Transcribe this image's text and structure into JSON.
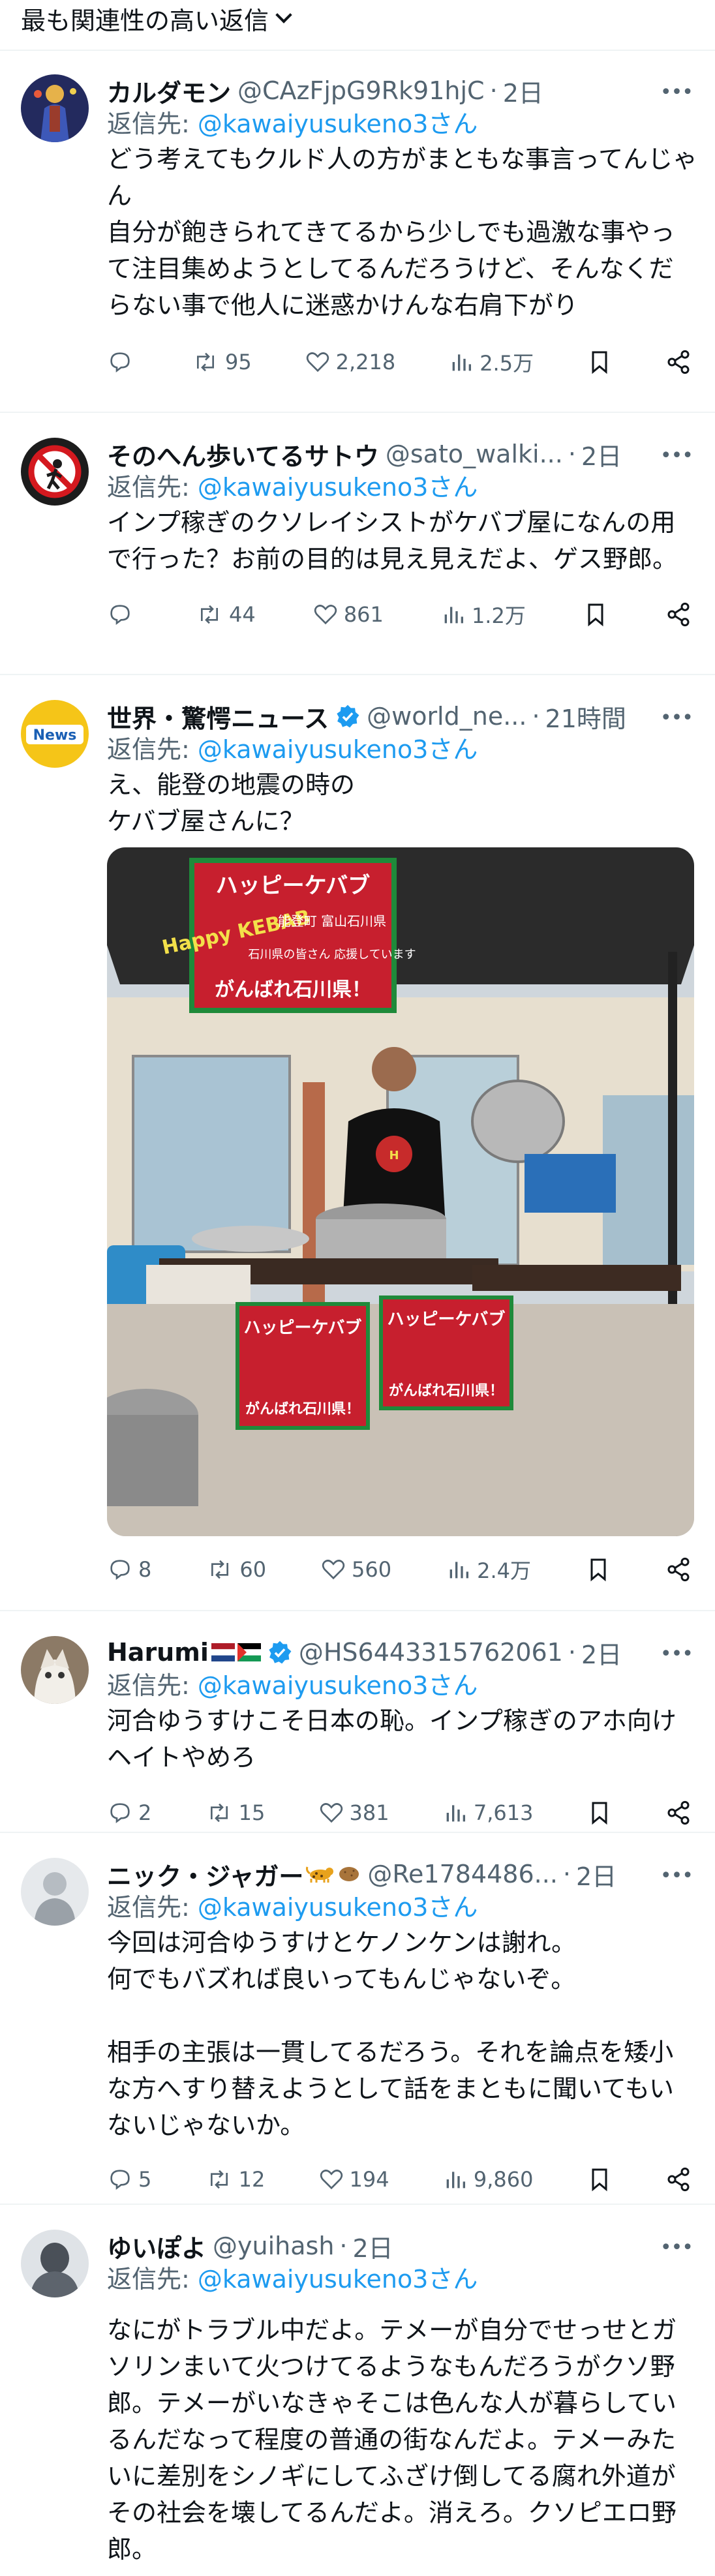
{
  "sort": {
    "label": "最も関連性の高い返信"
  },
  "reply_prefix": "返信先: ",
  "tweets": [
    {
      "name": "カルダモン",
      "handle": "@CAzFjpG9Rk91hjC",
      "time": "2日",
      "reply_to": "@kawaiyusukeno3さん",
      "text": "どう考えてもクルド人の方がまともな事言ってんじゃん\n自分が飽きられてきてるから少しでも過激な事やって注目集めようとしてるんだろうけど、そんなくだらない事で他人に迷惑かけんな右肩下がり",
      "replies": "",
      "reposts": "95",
      "likes": "2,218",
      "views": "2.5万"
    },
    {
      "name": "そのへん歩いてるサトウ",
      "handle": "@sato_walki...",
      "time": "2日",
      "reply_to": "@kawaiyusukeno3さん",
      "text": "インプ稼ぎのクソレイシストがケバブ屋になんの用で行った？お前の目的は見え見えだよ、ゲス野郎。",
      "replies": "",
      "reposts": "44",
      "likes": "861",
      "views": "1.2万"
    },
    {
      "name": "世界・驚愕ニュース",
      "handle": "@world_ne...",
      "time": "21時間",
      "reply_to": "@kawaiyusukeno3さん",
      "text": "え、能登の地震の時の\nケバブ屋さんに？",
      "avatar_text": "News",
      "image": {
        "banner_title": "ハッピーケバブ",
        "banner_sub": "能登町\n富山石川県",
        "banner_logo": "Happy KEBAB",
        "banner_msg": "石川県の皆さん\n応援しています",
        "banner_bottom": "がんばれ石川県！"
      },
      "replies": "8",
      "reposts": "60",
      "likes": "560",
      "views": "2.4万"
    },
    {
      "name": "Harumi",
      "handle": "@HS6443315762061",
      "time": "2日",
      "reply_to": "@kawaiyusukeno3さん",
      "text": "河合ゆうすけこそ日本の恥。インプ稼ぎのアホ向けヘイトやめろ",
      "replies": "2",
      "reposts": "15",
      "likes": "381",
      "views": "7,613"
    },
    {
      "name": "ニック・ジャガー",
      "handle": "@Re1784486...",
      "time": "2日",
      "reply_to": "@kawaiyusukeno3さん",
      "text": "今回は河合ゆうすけとケノンケンは謝れ。\n何でもバズれば良いってもんじゃないぞ。\n\n相手の主張は一貫してるだろう。それを論点を矮小な方へすり替えようとして話をまともに聞いてもいないじゃないか。",
      "replies": "5",
      "reposts": "12",
      "likes": "194",
      "views": "9,860"
    },
    {
      "name": "ゆいぽよ",
      "handle": "@yuihash",
      "time": "2日",
      "reply_to": "@kawaiyusukeno3さん",
      "text": "なにがトラブル中だよ。テメーが自分でせっせとガソリンまいて火つけてるようなもんだろうがクソ野郎。テメーがいなきゃそこは色んな人が暮らしているんだなって程度の普通の街なんだよ。テメーみたいに差別をシノギにしてふざけ倒してる腐れ外道がその社会を壊してるんだよ。消えろ。クソピエロ野郎。",
      "replies": "",
      "reposts": "",
      "likes": "",
      "views": ""
    }
  ],
  "icons": [
    "chevron-down-icon",
    "more-icon",
    "reply-icon",
    "repost-icon",
    "like-icon",
    "views-icon",
    "bookmark-icon",
    "share-icon",
    "verified-badge-icon"
  ],
  "colors": {
    "accent": "#1d9bf0",
    "muted": "#536471",
    "text": "#0f1419",
    "divider": "#eff3f4"
  }
}
